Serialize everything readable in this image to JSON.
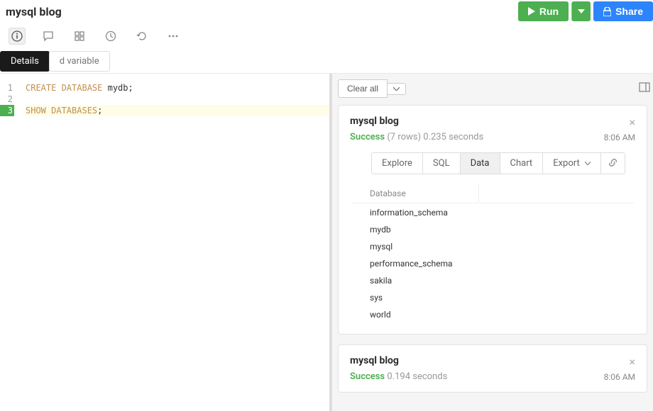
{
  "header": {
    "title": "mysql blog",
    "run_label": "Run",
    "share_label": "Share"
  },
  "tabs": {
    "details_label": "Details",
    "variable_label": "d variable"
  },
  "editor": {
    "lines": [
      {
        "num": "1",
        "kw": "CREATE DATABASE ",
        "rest": "mydb;"
      },
      {
        "num": "2",
        "kw": "",
        "rest": ""
      },
      {
        "num": "3",
        "kw": "SHOW DATABASES",
        "rest": ";"
      }
    ]
  },
  "results_toolbar": {
    "clear_label": "Clear all"
  },
  "result1": {
    "title": "mysql blog",
    "status": "Success",
    "rows_time": "(7 rows) 0.235 seconds",
    "timestamp": "8:06 AM",
    "tabs": {
      "explore": "Explore",
      "sql": "SQL",
      "data": "Data",
      "chart": "Chart",
      "export": "Export"
    },
    "table": {
      "header": "Database",
      "rows": [
        "information_schema",
        "mydb",
        "mysql",
        "performance_schema",
        "sakila",
        "sys",
        "world"
      ]
    }
  },
  "result2": {
    "title": "mysql blog",
    "status": "Success",
    "time": "0.194 seconds",
    "timestamp": "8:06 AM"
  }
}
